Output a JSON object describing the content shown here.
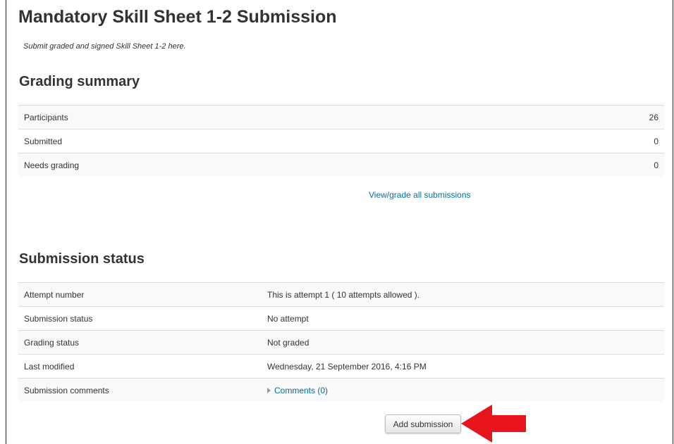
{
  "page": {
    "title": "Mandatory Skill Sheet 1-2 Submission",
    "intro": "Submit graded and signed Skill Sheet 1-2 here."
  },
  "grading_summary": {
    "heading": "Grading summary",
    "rows": [
      {
        "label": "Participants",
        "value": "26"
      },
      {
        "label": "Submitted",
        "value": "0"
      },
      {
        "label": "Needs grading",
        "value": "0"
      }
    ],
    "view_link": "View/grade all submissions"
  },
  "submission_status": {
    "heading": "Submission status",
    "rows": [
      {
        "label": "Attempt number",
        "value": "This is attempt 1 ( 10 attempts allowed )."
      },
      {
        "label": "Submission status",
        "value": "No attempt"
      },
      {
        "label": "Grading status",
        "value": "Not graded"
      },
      {
        "label": "Last modified",
        "value": "Wednesday, 21 September 2016, 4:16 PM"
      },
      {
        "label": "Submission comments",
        "value": "Comments (0)"
      }
    ]
  },
  "actions": {
    "add_submission": "Add submission"
  },
  "colors": {
    "link": "#0070a8",
    "arrow": "#e8141c"
  }
}
